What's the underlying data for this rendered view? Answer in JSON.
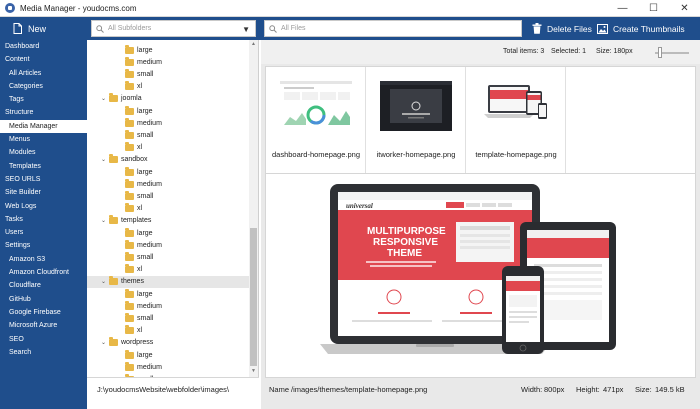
{
  "window": {
    "title": "Media Manager - youdocms.com",
    "controls": [
      "—",
      "☐",
      "✕"
    ]
  },
  "toolbar": {
    "new_label": "New",
    "subfolder_placeholder": "All Subfolders",
    "files_placeholder": "All Files",
    "delete_label": "Delete Files",
    "thumbnails_label": "Create Thumbnails"
  },
  "sidebar": {
    "items": [
      {
        "label": "Dashboard",
        "indent": false,
        "active": false
      },
      {
        "label": "Content",
        "indent": false,
        "active": false
      },
      {
        "label": "All Articles",
        "indent": true,
        "active": false
      },
      {
        "label": "Categories",
        "indent": true,
        "active": false
      },
      {
        "label": "Tags",
        "indent": true,
        "active": false
      },
      {
        "label": "Structure",
        "indent": false,
        "active": false
      },
      {
        "label": "Media Manager",
        "indent": true,
        "active": true
      },
      {
        "label": "Menus",
        "indent": true,
        "active": false
      },
      {
        "label": "Modules",
        "indent": true,
        "active": false
      },
      {
        "label": "Templates",
        "indent": true,
        "active": false
      },
      {
        "label": "SEO URLS",
        "indent": false,
        "active": false
      },
      {
        "label": "Site Builder",
        "indent": false,
        "active": false
      },
      {
        "label": "Web Logs",
        "indent": false,
        "active": false
      },
      {
        "label": "Tasks",
        "indent": false,
        "active": false
      },
      {
        "label": "Users",
        "indent": false,
        "active": false
      },
      {
        "label": "Settings",
        "indent": false,
        "active": false
      },
      {
        "label": "Amazon S3",
        "indent": true,
        "active": false
      },
      {
        "label": "Amazon Cloudfront",
        "indent": true,
        "active": false
      },
      {
        "label": "Cloudflare",
        "indent": true,
        "active": false
      },
      {
        "label": "GitHub",
        "indent": true,
        "active": false
      },
      {
        "label": "Google Firebase",
        "indent": true,
        "active": false
      },
      {
        "label": "Microsoft Azure",
        "indent": true,
        "active": false
      },
      {
        "label": "SEO",
        "indent": true,
        "active": false
      },
      {
        "label": "Search",
        "indent": true,
        "active": false
      }
    ]
  },
  "folders": {
    "rows": [
      {
        "label": "large",
        "level": 2,
        "expandable": false,
        "selected": false
      },
      {
        "label": "medium",
        "level": 2,
        "expandable": false,
        "selected": false
      },
      {
        "label": "small",
        "level": 2,
        "expandable": false,
        "selected": false
      },
      {
        "label": "xl",
        "level": 2,
        "expandable": false,
        "selected": false
      },
      {
        "label": "joomla",
        "level": 1,
        "expandable": true,
        "selected": false
      },
      {
        "label": "large",
        "level": 2,
        "expandable": false,
        "selected": false
      },
      {
        "label": "medium",
        "level": 2,
        "expandable": false,
        "selected": false
      },
      {
        "label": "small",
        "level": 2,
        "expandable": false,
        "selected": false
      },
      {
        "label": "xl",
        "level": 2,
        "expandable": false,
        "selected": false
      },
      {
        "label": "sandbox",
        "level": 1,
        "expandable": true,
        "selected": false
      },
      {
        "label": "large",
        "level": 2,
        "expandable": false,
        "selected": false
      },
      {
        "label": "medium",
        "level": 2,
        "expandable": false,
        "selected": false
      },
      {
        "label": "small",
        "level": 2,
        "expandable": false,
        "selected": false
      },
      {
        "label": "xl",
        "level": 2,
        "expandable": false,
        "selected": false
      },
      {
        "label": "templates",
        "level": 1,
        "expandable": true,
        "selected": false
      },
      {
        "label": "large",
        "level": 2,
        "expandable": false,
        "selected": false
      },
      {
        "label": "medium",
        "level": 2,
        "expandable": false,
        "selected": false
      },
      {
        "label": "small",
        "level": 2,
        "expandable": false,
        "selected": false
      },
      {
        "label": "xl",
        "level": 2,
        "expandable": false,
        "selected": false
      },
      {
        "label": "themes",
        "level": 1,
        "expandable": true,
        "selected": true
      },
      {
        "label": "large",
        "level": 2,
        "expandable": false,
        "selected": false
      },
      {
        "label": "medium",
        "level": 2,
        "expandable": false,
        "selected": false
      },
      {
        "label": "small",
        "level": 2,
        "expandable": false,
        "selected": false
      },
      {
        "label": "xl",
        "level": 2,
        "expandable": false,
        "selected": false
      },
      {
        "label": "wordpress",
        "level": 1,
        "expandable": true,
        "selected": false
      },
      {
        "label": "large",
        "level": 2,
        "expandable": false,
        "selected": false
      },
      {
        "label": "medium",
        "level": 2,
        "expandable": false,
        "selected": false
      },
      {
        "label": "small",
        "level": 2,
        "expandable": false,
        "selected": false
      }
    ],
    "current_path": "J:\\youdocmsWebsite\\webfolder\\images\\"
  },
  "stats": {
    "total_label": "Total items: 3",
    "selected_label": "Selected: 1",
    "size_label": "Size: 180px"
  },
  "files": [
    {
      "name": "dashboard-homepage.png"
    },
    {
      "name": "itworker-homepage.png"
    },
    {
      "name": "template-homepage.png"
    }
  ],
  "preview": {
    "brand_text": "universal",
    "headline_1": "MULTIPURPOSE",
    "headline_2": "RESPONSIVE",
    "headline_3": "THEME"
  },
  "info": {
    "name_label": "Name",
    "name_value": "/images/themes/template-homepage.png",
    "width_label": "Width:",
    "width_value": "800px",
    "height_label": "Height:",
    "height_value": "471px",
    "size_label": "Size:",
    "size_value": "149.5 kB"
  },
  "colors": {
    "brand_blue": "#1f4e8c",
    "folder_yellow": "#e8b847",
    "theme_red": "#e0474f"
  }
}
